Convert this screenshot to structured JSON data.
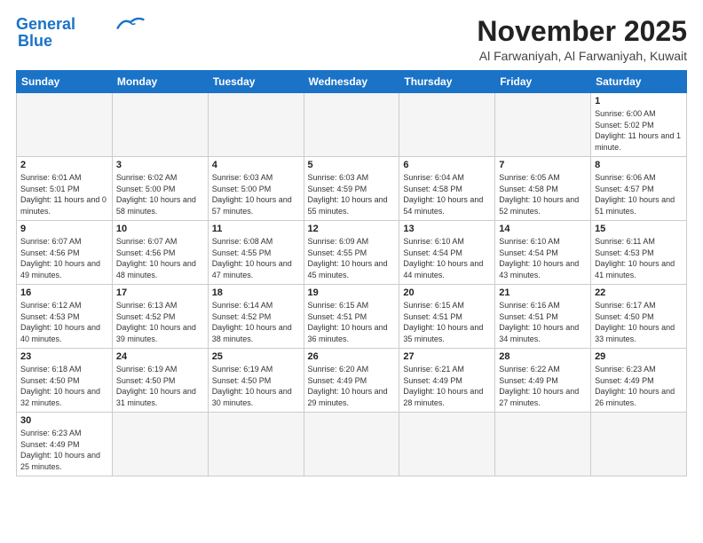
{
  "logo": {
    "line1": "General",
    "line2": "Blue"
  },
  "header": {
    "title": "November 2025",
    "subtitle": "Al Farwaniyah, Al Farwaniyah, Kuwait"
  },
  "weekdays": [
    "Sunday",
    "Monday",
    "Tuesday",
    "Wednesday",
    "Thursday",
    "Friday",
    "Saturday"
  ],
  "weeks": [
    [
      {
        "day": "",
        "info": ""
      },
      {
        "day": "",
        "info": ""
      },
      {
        "day": "",
        "info": ""
      },
      {
        "day": "",
        "info": ""
      },
      {
        "day": "",
        "info": ""
      },
      {
        "day": "",
        "info": ""
      },
      {
        "day": "1",
        "info": "Sunrise: 6:00 AM\nSunset: 5:02 PM\nDaylight: 11 hours\nand 1 minute."
      }
    ],
    [
      {
        "day": "2",
        "info": "Sunrise: 6:01 AM\nSunset: 5:01 PM\nDaylight: 11 hours\nand 0 minutes."
      },
      {
        "day": "3",
        "info": "Sunrise: 6:02 AM\nSunset: 5:00 PM\nDaylight: 10 hours\nand 58 minutes."
      },
      {
        "day": "4",
        "info": "Sunrise: 6:03 AM\nSunset: 5:00 PM\nDaylight: 10 hours\nand 57 minutes."
      },
      {
        "day": "5",
        "info": "Sunrise: 6:03 AM\nSunset: 4:59 PM\nDaylight: 10 hours\nand 55 minutes."
      },
      {
        "day": "6",
        "info": "Sunrise: 6:04 AM\nSunset: 4:58 PM\nDaylight: 10 hours\nand 54 minutes."
      },
      {
        "day": "7",
        "info": "Sunrise: 6:05 AM\nSunset: 4:58 PM\nDaylight: 10 hours\nand 52 minutes."
      },
      {
        "day": "8",
        "info": "Sunrise: 6:06 AM\nSunset: 4:57 PM\nDaylight: 10 hours\nand 51 minutes."
      }
    ],
    [
      {
        "day": "9",
        "info": "Sunrise: 6:07 AM\nSunset: 4:56 PM\nDaylight: 10 hours\nand 49 minutes."
      },
      {
        "day": "10",
        "info": "Sunrise: 6:07 AM\nSunset: 4:56 PM\nDaylight: 10 hours\nand 48 minutes."
      },
      {
        "day": "11",
        "info": "Sunrise: 6:08 AM\nSunset: 4:55 PM\nDaylight: 10 hours\nand 47 minutes."
      },
      {
        "day": "12",
        "info": "Sunrise: 6:09 AM\nSunset: 4:55 PM\nDaylight: 10 hours\nand 45 minutes."
      },
      {
        "day": "13",
        "info": "Sunrise: 6:10 AM\nSunset: 4:54 PM\nDaylight: 10 hours\nand 44 minutes."
      },
      {
        "day": "14",
        "info": "Sunrise: 6:10 AM\nSunset: 4:54 PM\nDaylight: 10 hours\nand 43 minutes."
      },
      {
        "day": "15",
        "info": "Sunrise: 6:11 AM\nSunset: 4:53 PM\nDaylight: 10 hours\nand 41 minutes."
      }
    ],
    [
      {
        "day": "16",
        "info": "Sunrise: 6:12 AM\nSunset: 4:53 PM\nDaylight: 10 hours\nand 40 minutes."
      },
      {
        "day": "17",
        "info": "Sunrise: 6:13 AM\nSunset: 4:52 PM\nDaylight: 10 hours\nand 39 minutes."
      },
      {
        "day": "18",
        "info": "Sunrise: 6:14 AM\nSunset: 4:52 PM\nDaylight: 10 hours\nand 38 minutes."
      },
      {
        "day": "19",
        "info": "Sunrise: 6:15 AM\nSunset: 4:51 PM\nDaylight: 10 hours\nand 36 minutes."
      },
      {
        "day": "20",
        "info": "Sunrise: 6:15 AM\nSunset: 4:51 PM\nDaylight: 10 hours\nand 35 minutes."
      },
      {
        "day": "21",
        "info": "Sunrise: 6:16 AM\nSunset: 4:51 PM\nDaylight: 10 hours\nand 34 minutes."
      },
      {
        "day": "22",
        "info": "Sunrise: 6:17 AM\nSunset: 4:50 PM\nDaylight: 10 hours\nand 33 minutes."
      }
    ],
    [
      {
        "day": "23",
        "info": "Sunrise: 6:18 AM\nSunset: 4:50 PM\nDaylight: 10 hours\nand 32 minutes."
      },
      {
        "day": "24",
        "info": "Sunrise: 6:19 AM\nSunset: 4:50 PM\nDaylight: 10 hours\nand 31 minutes."
      },
      {
        "day": "25",
        "info": "Sunrise: 6:19 AM\nSunset: 4:50 PM\nDaylight: 10 hours\nand 30 minutes."
      },
      {
        "day": "26",
        "info": "Sunrise: 6:20 AM\nSunset: 4:49 PM\nDaylight: 10 hours\nand 29 minutes."
      },
      {
        "day": "27",
        "info": "Sunrise: 6:21 AM\nSunset: 4:49 PM\nDaylight: 10 hours\nand 28 minutes."
      },
      {
        "day": "28",
        "info": "Sunrise: 6:22 AM\nSunset: 4:49 PM\nDaylight: 10 hours\nand 27 minutes."
      },
      {
        "day": "29",
        "info": "Sunrise: 6:23 AM\nSunset: 4:49 PM\nDaylight: 10 hours\nand 26 minutes."
      }
    ],
    [
      {
        "day": "30",
        "info": "Sunrise: 6:23 AM\nSunset: 4:49 PM\nDaylight: 10 hours\nand 25 minutes."
      },
      {
        "day": "",
        "info": ""
      },
      {
        "day": "",
        "info": ""
      },
      {
        "day": "",
        "info": ""
      },
      {
        "day": "",
        "info": ""
      },
      {
        "day": "",
        "info": ""
      },
      {
        "day": "",
        "info": ""
      }
    ]
  ]
}
